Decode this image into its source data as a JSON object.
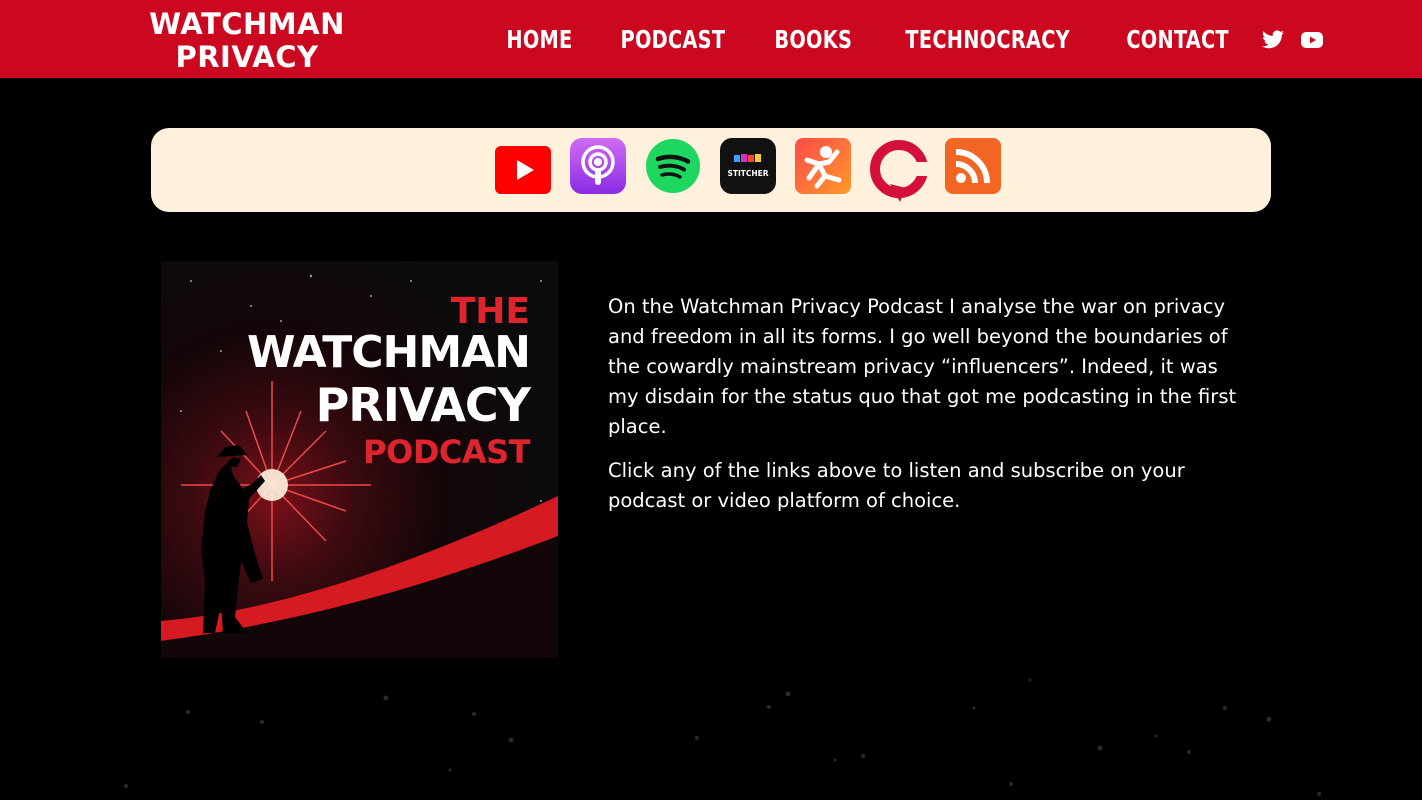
{
  "header": {
    "logo_line1": "WATCHMAN",
    "logo_line2": "PRIVACY",
    "nav": [
      "HOME",
      "PODCAST",
      "BOOKS",
      "TECHNOCRACY",
      "CONTACT"
    ],
    "social_icons": [
      "twitter-icon",
      "youtube-icon"
    ],
    "background": "#cc0820"
  },
  "platforms": {
    "background": "#fff1dc",
    "icons": [
      "youtube-icon",
      "apple-podcasts-icon",
      "spotify-icon",
      "stitcher-icon",
      "castbox-icon",
      "castro-icon",
      "rss-icon"
    ],
    "stitcher_label": "STITCHER"
  },
  "cover": {
    "the": "THE",
    "line1": "WATCHMAN",
    "line2": "PRIVACY",
    "line3": "PODCAST"
  },
  "description": {
    "paragraph1": "On the Watchman Privacy Podcast I analyse the war on privacy and freedom in all its forms. I go well beyond the boundaries of the cowardly mainstream privacy “influencers”. Indeed, it was my disdain for the status quo that got me podcasting in the first place.",
    "paragraph2": "Click any of the links above to listen and subscribe on your podcast or video platform of choice."
  }
}
